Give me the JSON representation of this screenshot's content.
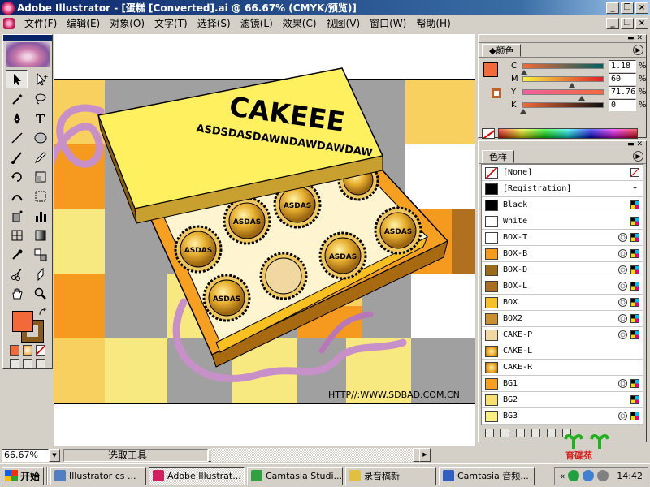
{
  "window": {
    "title": "Adobe Illustrator - [蛋糕 [Converted].ai @ 66.67% (CMYK/预览)]"
  },
  "menu": [
    "文件(F)",
    "编辑(E)",
    "对象(O)",
    "文字(T)",
    "选择(S)",
    "滤镜(L)",
    "效果(C)",
    "视图(V)",
    "窗口(W)",
    "帮助(H)"
  ],
  "artwork": {
    "brand": "CAKEEE",
    "tagline": "ASDSDASDAWNDAWDAWDAW",
    "cake_label": "ASDAS",
    "url": "HTTP//:WWW.SDBAD.COM.CN"
  },
  "color_panel": {
    "tab": "颜色",
    "channels": [
      {
        "label": "C",
        "value": "1.18",
        "pct": "%",
        "level": 1.18
      },
      {
        "label": "M",
        "value": "60",
        "pct": "%",
        "level": 60
      },
      {
        "label": "Y",
        "value": "71.76",
        "pct": "%",
        "level": 71.76
      },
      {
        "label": "K",
        "value": "0",
        "pct": "%",
        "level": 0
      }
    ],
    "fill_color": "#f26a3a"
  },
  "swatches_panel": {
    "tab": "色样",
    "items": [
      {
        "name": "[None]",
        "color": "none",
        "icons": [
          "none"
        ]
      },
      {
        "name": "[Registration]",
        "color": "#000000",
        "icons": [
          "reg"
        ]
      },
      {
        "name": "Black",
        "color": "#000000",
        "icons": [
          "cmyk"
        ]
      },
      {
        "name": "White",
        "color": "#ffffff",
        "icons": [
          "cmyk"
        ]
      },
      {
        "name": "BOX-T",
        "color": "#ffffff",
        "icons": [
          "proc",
          "cmyk"
        ]
      },
      {
        "name": "BOX-B",
        "color": "#f59a1e",
        "icons": [
          "proc",
          "cmyk"
        ]
      },
      {
        "name": "BOX-D",
        "color": "#9a6a1a",
        "icons": [
          "proc",
          "cmyk"
        ]
      },
      {
        "name": "BOX-L",
        "color": "#a8701e",
        "icons": [
          "proc",
          "cmyk"
        ]
      },
      {
        "name": "BOX",
        "color": "#f5c028",
        "icons": [
          "proc",
          "cmyk"
        ]
      },
      {
        "name": "BOX2",
        "color": "#c89030",
        "icons": [
          "proc",
          "cmyk"
        ]
      },
      {
        "name": "CAKE-P",
        "color": "#f0d8a0",
        "icons": [
          "proc",
          "cmyk"
        ]
      },
      {
        "name": "CAKE-L",
        "color": "radial",
        "icons": []
      },
      {
        "name": "CAKE-R",
        "color": "radial",
        "icons": []
      },
      {
        "name": "BG1",
        "color": "#f5a020",
        "icons": [
          "proc",
          "cmyk"
        ]
      },
      {
        "name": "BG2",
        "color": "#f8e070",
        "icons": [
          "cmyk"
        ]
      },
      {
        "name": "BG3",
        "color": "#f8f080",
        "icons": [
          "proc",
          "cmyk"
        ]
      }
    ]
  },
  "statusbar": {
    "zoom": "66.67%",
    "tool": "选取工具",
    "logo_text": "育碟苑"
  },
  "taskbar": {
    "start": "开始",
    "tasks": [
      {
        "label": "Illustrator cs ...",
        "icon_color": "#5080c0",
        "active": false
      },
      {
        "label": "Adobe Illustrat...",
        "icon_color": "#d02060",
        "active": true
      },
      {
        "label": "Camtasia Studi...",
        "icon_color": "#30a040",
        "active": false
      },
      {
        "label": "录音稿新",
        "icon_color": "#e0c040",
        "active": false
      },
      {
        "label": "Camtasia 音频...",
        "icon_color": "#3060c0",
        "active": false
      }
    ],
    "clock": "14:42"
  }
}
